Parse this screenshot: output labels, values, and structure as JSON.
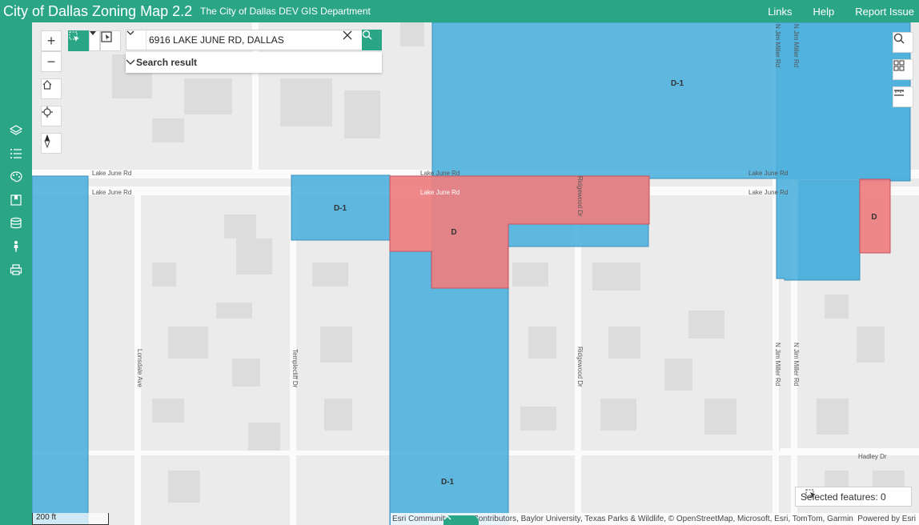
{
  "header": {
    "title": "City of Dallas Zoning Map 2.2",
    "subtitle": "The City of Dallas DEV GIS Department",
    "links": [
      "Links",
      "Help",
      "Report Issue"
    ]
  },
  "sidebar": {
    "icons": [
      "layers-icon",
      "legend-icon",
      "palette-icon",
      "bookmark-icon",
      "database-icon",
      "pegman-icon",
      "print-icon"
    ]
  },
  "map_tools": {
    "zoom_in": "+",
    "zoom_out": "−"
  },
  "search": {
    "value": "6916 LAKE JUNE RD, DALLAS",
    "result_label": "Search result"
  },
  "map": {
    "zones": [
      {
        "label": "D-1",
        "type": "blue"
      },
      {
        "label": "D-1",
        "type": "blue"
      },
      {
        "label": "D",
        "type": "red"
      },
      {
        "label": "D",
        "type": "red"
      },
      {
        "label": "D-1",
        "type": "blue"
      }
    ],
    "street_labels": [
      "Lake June Rd",
      "Lake June Rd",
      "Lake June Rd",
      "Lake June Rd",
      "Lake June Rd",
      "Lake June Rd",
      "Ridgewood Dr",
      "Ridgewood Dr",
      "Lonsdale Ave",
      "Templecliff Dr",
      "N Jim Miller Rd",
      "N Jim Miller Rd",
      "N Jim Miller Rd",
      "N Jim Miller Rd",
      "Hadley Dr"
    ],
    "colors": {
      "blue_zone": "#4fb1dd",
      "red_zone": "#ee7f7f",
      "accent": "#2aa686"
    }
  },
  "selected_features": "Selected features: 0",
  "attribution": {
    "text": "Esri Community Maps Contributors, Baylor University, Texas Parks & Wildlife, © OpenStreetMap, Microsoft, Esri, TomTom, Garmin, Saf...",
    "powered": "Powered by Esri"
  },
  "scale": "200 ft"
}
